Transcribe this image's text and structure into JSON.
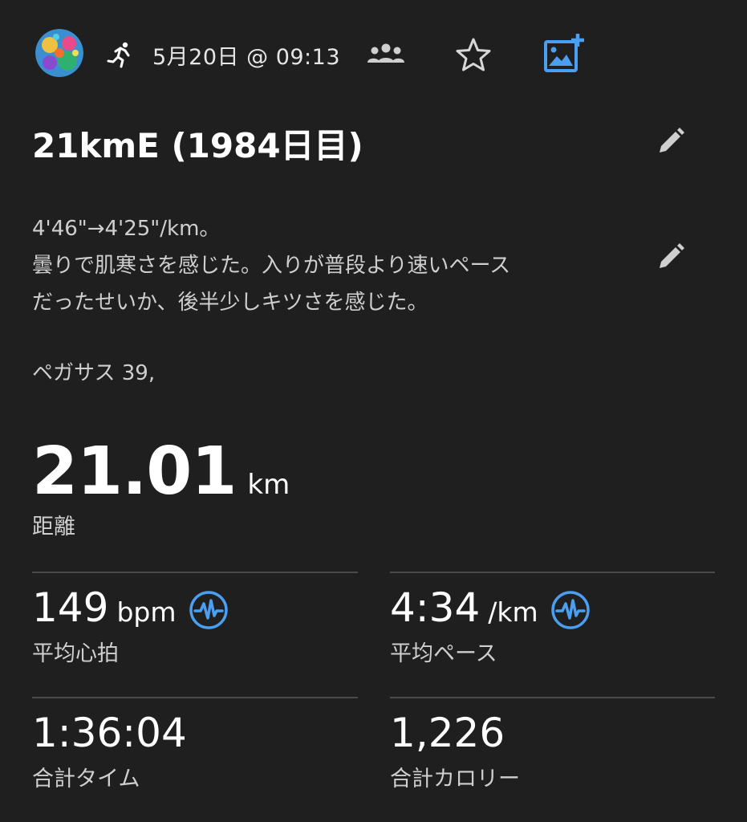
{
  "header": {
    "avatar_icon": "profile-avatar",
    "activity_icon": "running-icon",
    "date": "5月20日 @ 09:13",
    "group_icon": "group-icon",
    "star_icon": "star-icon",
    "photo_icon": "add-photo-icon",
    "accent_color": "#4a9ff0"
  },
  "activity": {
    "title": "21kmE (1984日目)",
    "description_lines": [
      "4'46\"→4'25\"/km。",
      "曇りで肌寒さを感じた。入りが普段より速いペース",
      "だったせいか、後半少しキツさを感じた。"
    ],
    "shoe": "ペガサス 39,"
  },
  "distance": {
    "value": "21.01",
    "unit": "km",
    "label": "距離"
  },
  "stats": {
    "heart_rate": {
      "value": "149",
      "unit": "bpm",
      "label": "平均心拍"
    },
    "pace": {
      "value": "4:34",
      "unit": "/km",
      "label": "平均ペース"
    },
    "total_time": {
      "value": "1:36:04",
      "label": "合計タイム"
    },
    "calories": {
      "value": "1,226",
      "label": "合計カロリー"
    }
  }
}
